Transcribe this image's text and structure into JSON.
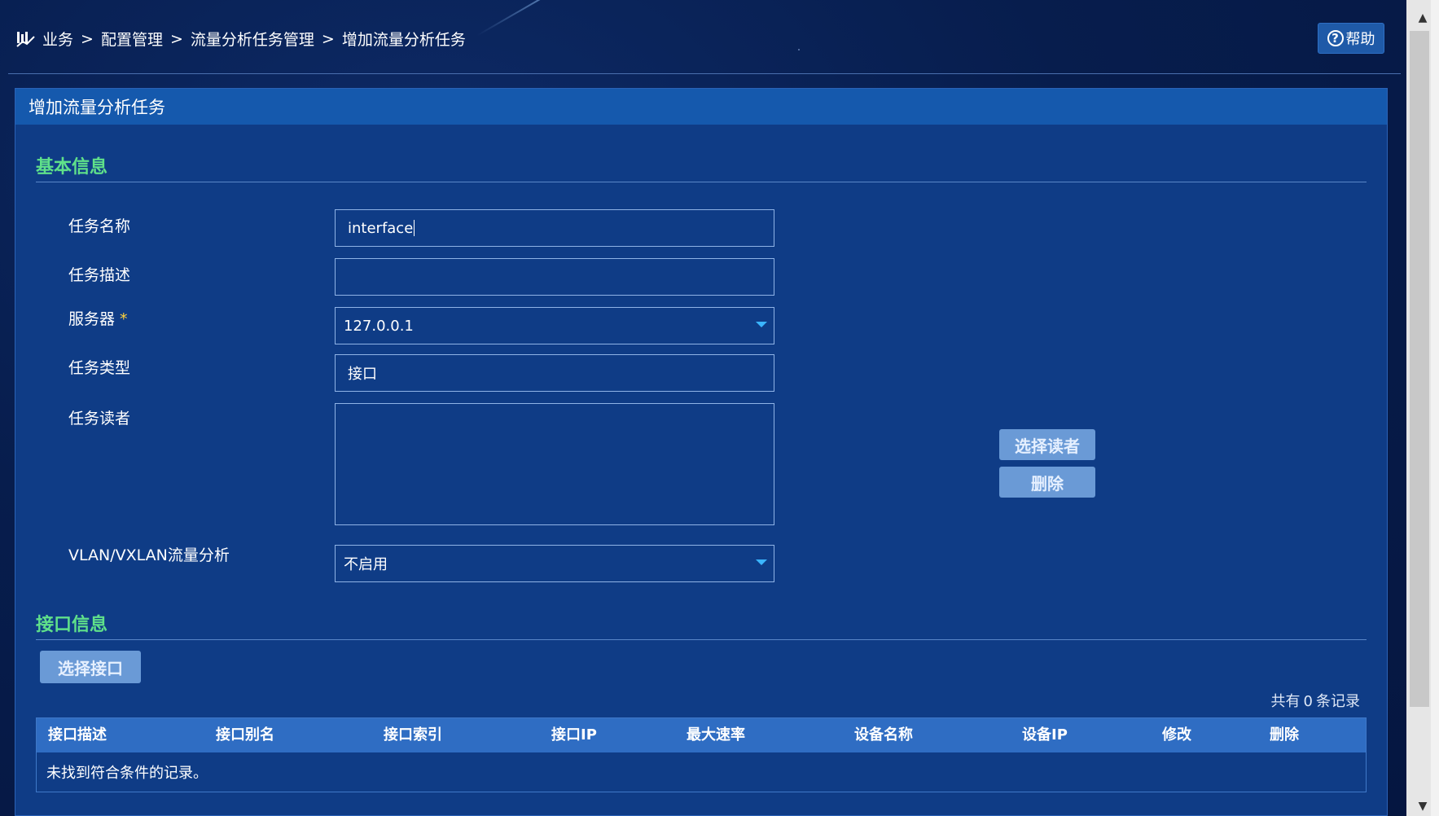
{
  "breadcrumb": {
    "items": [
      "业务",
      "配置管理",
      "流量分析任务管理",
      "增加流量分析任务"
    ],
    "separator": ">"
  },
  "help": {
    "label": "帮助"
  },
  "panel": {
    "title": "增加流量分析任务"
  },
  "basic_info": {
    "title": "基本信息",
    "task_name": {
      "label": "任务名称",
      "value": "interface"
    },
    "task_desc": {
      "label": "任务描述",
      "value": ""
    },
    "server": {
      "label": "服务器",
      "required_mark": "*",
      "selected": "127.0.0.1"
    },
    "task_type": {
      "label": "任务类型",
      "value": "接口"
    },
    "task_reader": {
      "label": "任务读者",
      "value": ""
    },
    "vlan": {
      "label": "VLAN/VXLAN流量分析",
      "selected": "不启用"
    },
    "select_reader_label": "选择读者",
    "delete_label": "删除"
  },
  "interface_info": {
    "title": "接口信息",
    "select_interface_label": "选择接口",
    "records": {
      "prefix": "共有",
      "count": "0",
      "suffix": "条记录"
    },
    "columns": [
      "接口描述",
      "接口别名",
      "接口索引",
      "接口IP",
      "最大速率",
      "设备名称",
      "设备IP",
      "修改",
      "删除"
    ],
    "empty_message": "未找到符合条件的记录。"
  },
  "colors": {
    "background": "#071d4d",
    "panel": "#0f3c86",
    "panel_header": "#1559ad",
    "section_title": "#5fe08a",
    "button": "#6a9ad6",
    "table_header": "#2f6dc3",
    "required_mark": "#ffd23a"
  }
}
